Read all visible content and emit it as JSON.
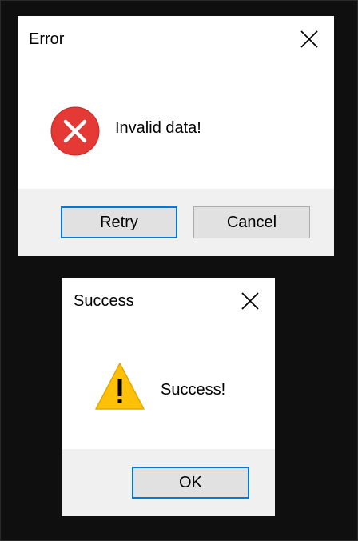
{
  "error_dialog": {
    "title": "Error",
    "message": "Invalid data!",
    "icon": "error-icon",
    "buttons": {
      "retry_label": "Retry",
      "cancel_label": "Cancel"
    },
    "default_button": "retry"
  },
  "success_dialog": {
    "title": "Success",
    "message": "Success!",
    "icon": "warning-icon",
    "buttons": {
      "ok_label": "OK"
    },
    "default_button": "ok"
  },
  "colors": {
    "desktop_background": "#0f0f0f",
    "dialog_background": "#ffffff",
    "footer_background": "#f0f0f0",
    "button_face": "#e1e1e1",
    "button_border": "#adadad",
    "focus_accent": "#0078d7",
    "error_red": "#e53935",
    "warning_yellow": "#ffc107"
  }
}
